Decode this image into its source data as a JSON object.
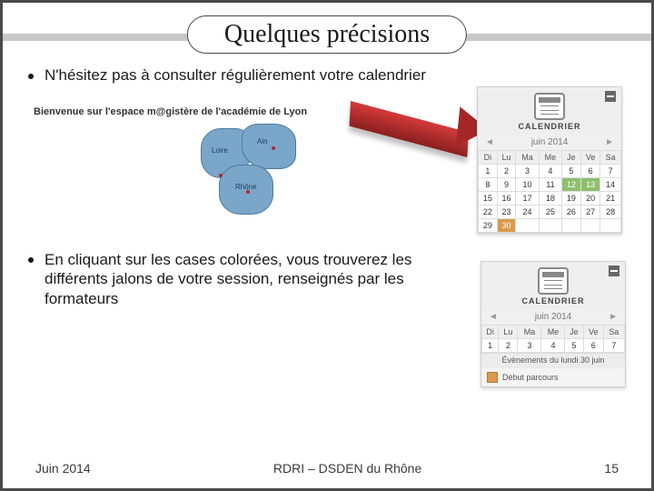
{
  "title": "Quelques précisions",
  "bullets": {
    "b1": "N'hésitez pas à consulter régulièrement votre calendrier",
    "b2": "En cliquant sur les cases colorées, vous trouverez les différents jalons de votre session, renseignés par les formateurs"
  },
  "welcome": "Bienvenue sur l'espace m@gistère de l'académie de Lyon",
  "map": {
    "r1": "Loire",
    "r2": "Ain",
    "r3": "Rhône"
  },
  "calendar": {
    "label": "CALENDRIER",
    "month": "juin 2014",
    "daysHeader": [
      "Di",
      "Lu",
      "Ma",
      "Me",
      "Je",
      "Ve",
      "Sa"
    ],
    "weeks": [
      [
        "1",
        "2",
        "3",
        "4",
        "5",
        "6",
        "7"
      ],
      [
        "8",
        "9",
        "10",
        "11",
        "12",
        "13",
        "14"
      ],
      [
        "15",
        "16",
        "17",
        "18",
        "19",
        "20",
        "21"
      ],
      [
        "22",
        "23",
        "24",
        "25",
        "26",
        "27",
        "28"
      ],
      [
        "29",
        "30",
        "",
        "",
        "",
        "",
        ""
      ]
    ],
    "eventBanner": "Évènements du lundi 30 juin",
    "eventItem": "Début parcours"
  },
  "footer": {
    "left": "Juin 2014",
    "center": "RDRI – DSDEN du Rhône",
    "right": "15"
  }
}
